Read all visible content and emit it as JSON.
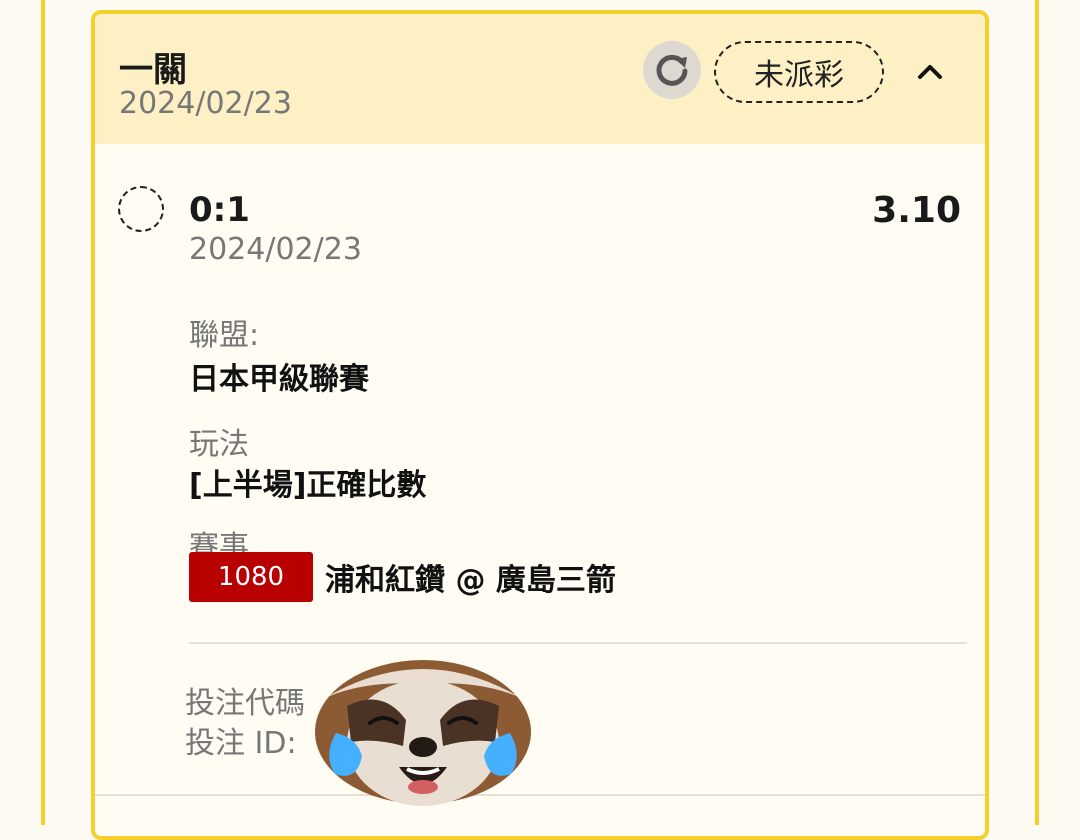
{
  "header": {
    "title": "一關",
    "date": "2024/02/23",
    "status": "未派彩"
  },
  "bet": {
    "selection": "0:1",
    "odds": "3.10",
    "date": "2024/02/23",
    "league_label": "聯盟:",
    "league": "日本甲級聯賽",
    "market_label": "玩法",
    "market": "[上半場]正確比數",
    "event_label": "賽事",
    "match_number": "1080",
    "match": "浦和紅鑽 @ 廣島三箭"
  },
  "footer": {
    "bet_code_label": "投注代碼",
    "bet_id_label": "投注 ID:"
  },
  "icons": {
    "refresh": "refresh-icon",
    "collapse": "chevron-up-icon",
    "sticker": "crying-sloth-emoji"
  },
  "colors": {
    "card_border": "#f5cf2c",
    "header_bg": "#fdf0c4",
    "match_badge": "#b80000"
  }
}
